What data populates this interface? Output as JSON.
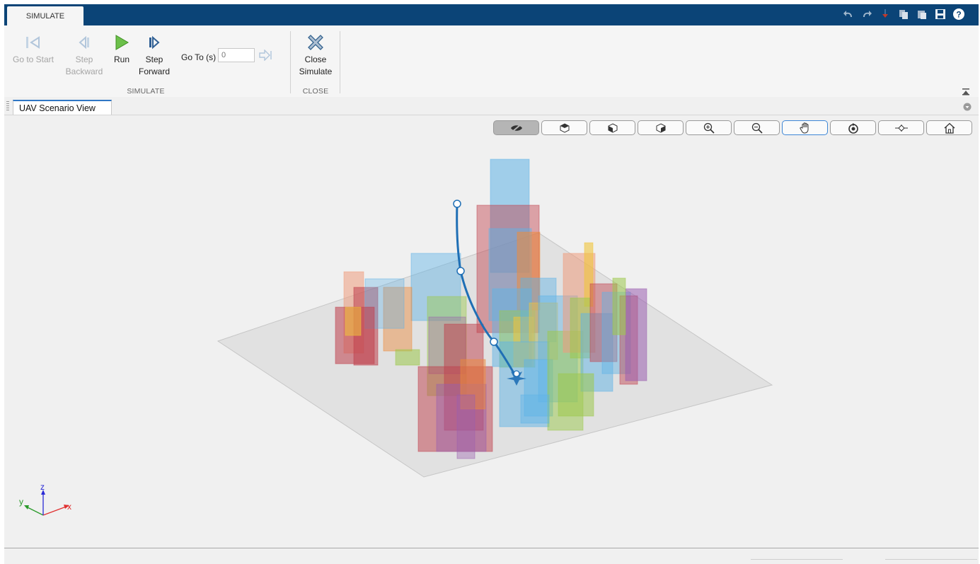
{
  "ribbon": {
    "tab_label": "SIMULATE"
  },
  "toolstrip": {
    "go_to_start": "Go to Start",
    "step_backward_line1": "Step",
    "step_backward_line2": "Backward",
    "run": "Run",
    "step_forward_line1": "Step",
    "step_forward_line2": "Forward",
    "go_to_label": "Go To (s)",
    "go_to_placeholder": "0",
    "simulate_group": "SIMULATE",
    "close_line1": "Close",
    "close_line2": "Simulate",
    "close_group": "CLOSE"
  },
  "document": {
    "tab_title": "UAV Scenario View"
  },
  "view_toolbar": [
    {
      "icon": "hide-icon",
      "active": true
    },
    {
      "icon": "view-cube-front-icon"
    },
    {
      "icon": "view-cube-side-icon"
    },
    {
      "icon": "view-cube-iso-icon"
    },
    {
      "icon": "zoom-in-icon"
    },
    {
      "icon": "zoom-out-icon"
    },
    {
      "icon": "pan-icon",
      "selected": true
    },
    {
      "icon": "rotate-icon"
    },
    {
      "icon": "data-cursor-icon"
    },
    {
      "icon": "home-icon"
    }
  ],
  "axes_triad": {
    "x": "x",
    "y": "y",
    "z": "z"
  },
  "colors": {
    "topbar": "#0b4477",
    "trajectory": "#1f6fb5",
    "run_green": "#4aa32d",
    "x_axis": "#e03030",
    "y_axis": "#2a9a2a",
    "z_axis": "#2a2ad6"
  }
}
